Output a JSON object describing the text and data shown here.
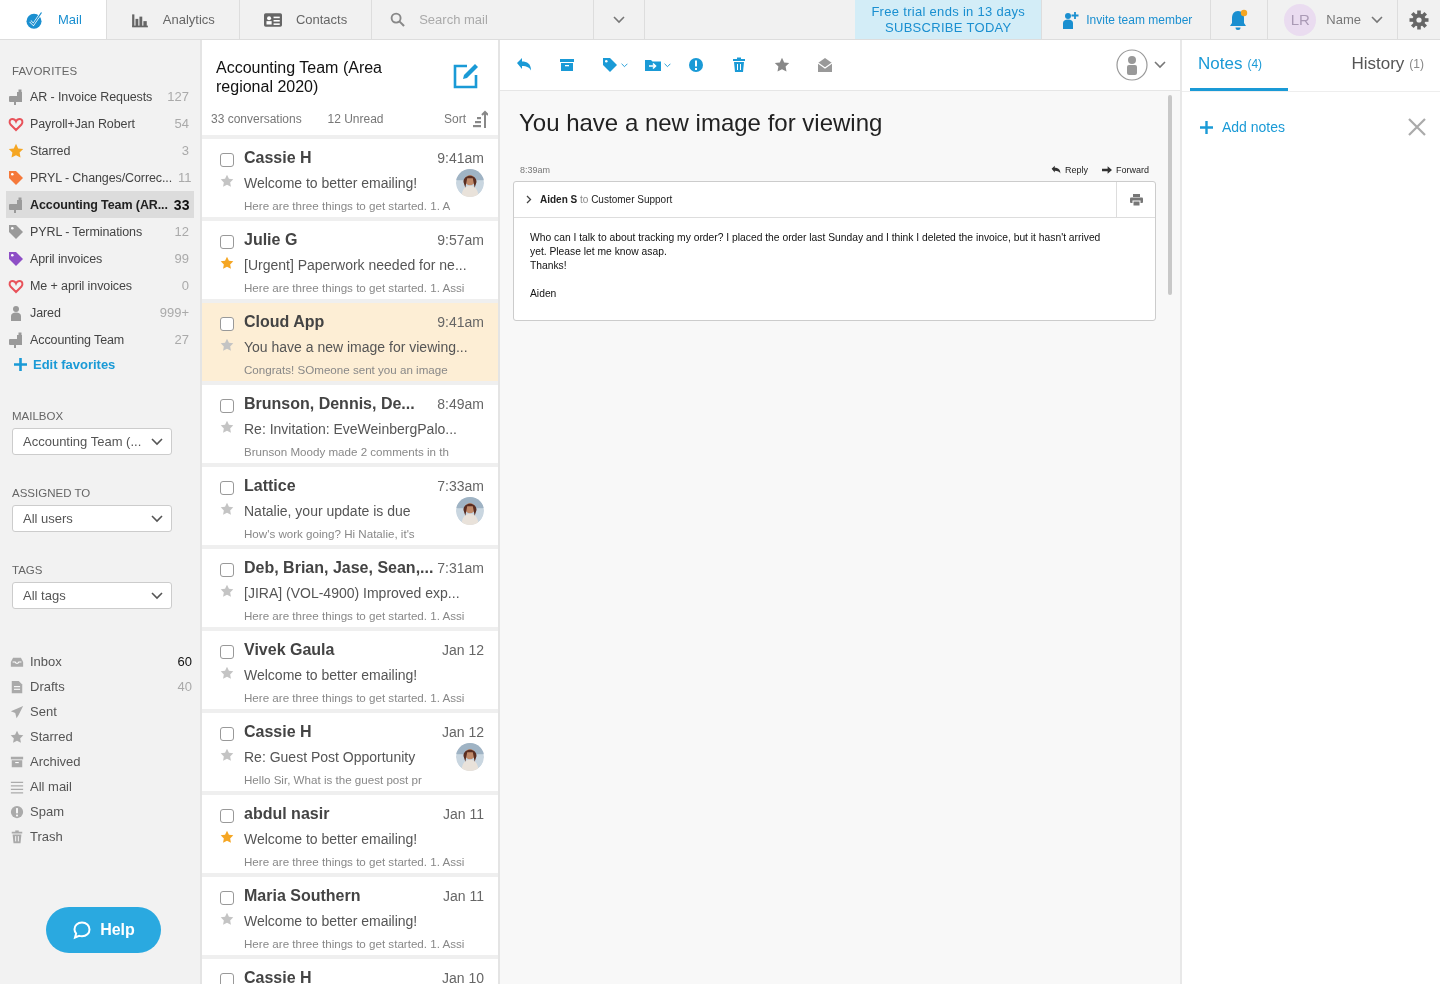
{
  "nav": {
    "tabs": [
      {
        "label": "Mail",
        "selected": true
      },
      {
        "label": "Analytics",
        "selected": false
      },
      {
        "label": "Contacts",
        "selected": false
      }
    ],
    "search": {
      "placeholder": "Search mail"
    },
    "trial": {
      "line1": "Free trial ends in 13 days",
      "line2": "SUBSCRIBE TODAY"
    },
    "invite": "Invite team member",
    "user": {
      "initials": "LR",
      "name": "Name"
    }
  },
  "favorites": {
    "heading": "FAVORITES",
    "items": [
      {
        "label": "AR - Invoice Requests",
        "count": "127",
        "kind": "mailbox",
        "color": "#9a9a9a",
        "selected": false
      },
      {
        "label": "Payroll+Jan Robert",
        "count": "54",
        "kind": "heart",
        "color": "#e8525a",
        "selected": false
      },
      {
        "label": "Starred",
        "count": "3",
        "kind": "star",
        "color": "#f5a623",
        "selected": false
      },
      {
        "label": "PRYL - Changes/Correc...",
        "count": "11",
        "kind": "tag",
        "color": "#f5793a",
        "selected": false
      },
      {
        "label": "Accounting Team (AR...",
        "count": "33",
        "kind": "mailbox",
        "color": "#9a9a9a",
        "selected": true
      },
      {
        "label": "PYRL - Terminations",
        "count": "12",
        "kind": "tag",
        "color": "#9a9a9a",
        "selected": false
      },
      {
        "label": "April invoices",
        "count": "99",
        "kind": "tag",
        "color": "#8e4fc6",
        "selected": false
      },
      {
        "label": "Me + april invoices",
        "count": "0",
        "kind": "heart",
        "color": "#e8525a",
        "selected": false
      },
      {
        "label": "Jared",
        "count": "999+",
        "kind": "person",
        "color": "#9a9a9a",
        "selected": false
      },
      {
        "label": "Accounting Team",
        "count": "27",
        "kind": "mailbox",
        "color": "#9a9a9a",
        "selected": false
      }
    ],
    "edit_label": "Edit favorites"
  },
  "filters": [
    {
      "label": "MAILBOX",
      "value": "Accounting Team (..."
    },
    {
      "label": "ASSIGNED TO",
      "value": "All users"
    },
    {
      "label": "TAGS",
      "value": "All tags"
    }
  ],
  "folders": [
    {
      "label": "Inbox",
      "count": "60",
      "unread": true
    },
    {
      "label": "Drafts",
      "count": "40",
      "unread": false
    },
    {
      "label": "Sent"
    },
    {
      "label": "Starred"
    },
    {
      "label": "Archived"
    },
    {
      "label": "All mail"
    },
    {
      "label": "Spam"
    },
    {
      "label": "Trash"
    }
  ],
  "help": "Help",
  "list": {
    "title": "Accounting Team (Area regional 2020)",
    "conversations": "33 conversations",
    "unread": "12 Unread",
    "sort": "Sort",
    "messages": [
      {
        "sender": "Cassie H",
        "time": "9:41am",
        "subject": "Welcome to better emailing!",
        "preview": "Here are three things to get started. 1. A",
        "checked": false,
        "starred": false,
        "selected": false,
        "avatar": true
      },
      {
        "sender": "Julie G",
        "time": "9:57am",
        "subject": "[Urgent] Paperwork needed for ne...",
        "preview": "Here are three things to get started. 1. Assi",
        "checked": false,
        "starred": true,
        "selected": false,
        "avatar": false
      },
      {
        "sender": "Cloud App",
        "time": "9:41am",
        "subject": "You have a new image for viewing...",
        "preview": "Congrats! SOmeone sent you an image",
        "checked": false,
        "starred": false,
        "selected": true,
        "avatar": false
      },
      {
        "sender": "Brunson, Dennis, De...",
        "time": "8:49am",
        "subject": "Re: Invitation: EveWeinbergPalo...",
        "preview": "Brunson Moody made 2 comments in th",
        "checked": false,
        "starred": false,
        "selected": false,
        "avatar": false
      },
      {
        "sender": "Lattice",
        "time": "7:33am",
        "subject": "Natalie, your update is due",
        "preview": "How's work going? Hi Natalie, it's",
        "checked": false,
        "starred": false,
        "selected": false,
        "avatar": true
      },
      {
        "sender": "Deb, Brian, Jase, Sean,...",
        "time": "7:31am",
        "subject": "[JIRA] (VOL-4900) Improved exp...",
        "preview": "Here are three things to get started. 1. Assi",
        "checked": false,
        "starred": false,
        "selected": false,
        "avatar": false
      },
      {
        "sender": "Vivek Gaula",
        "time": "Jan 12",
        "subject": "Welcome to better emailing!",
        "preview": "Here are three things to get started. 1. Assi",
        "checked": false,
        "starred": false,
        "selected": false,
        "avatar": false
      },
      {
        "sender": "Cassie H",
        "time": "Jan 12",
        "subject": "Re: Guest Post Opportunity",
        "preview": "Hello Sir, What is the guest  post pr",
        "checked": false,
        "starred": false,
        "selected": false,
        "avatar": true
      },
      {
        "sender": "abdul nasir",
        "time": "Jan 11",
        "subject": "Welcome to better emailing!",
        "preview": "Here are three things to get started. 1. Assi",
        "checked": false,
        "starred": true,
        "selected": false,
        "avatar": false
      },
      {
        "sender": "Maria Southern",
        "time": "Jan 11",
        "subject": "Welcome to better emailing!",
        "preview": "Here are three things to get started. 1. Assi",
        "checked": false,
        "starred": false,
        "selected": false,
        "avatar": false
      },
      {
        "sender": "Cassie H",
        "time": "Jan 10",
        "checked": false,
        "selected": false
      }
    ]
  },
  "reader": {
    "subject": "You have a new image for viewing",
    "time": "8:39am",
    "reply": "Reply",
    "forward": "Forward",
    "from": "Aiden S",
    "to_word": "to",
    "recipient": "Customer Support",
    "body": [
      "Who can I talk to about tracking my order? I placed the order last Sunday and I think I deleted the invoice, but it hasn't arrived yet. Please let me know asap.",
      "Thanks!"
    ],
    "signature": "Aiden"
  },
  "notes": {
    "tabs": [
      {
        "label": "Notes",
        "count": "(4)",
        "selected": true
      },
      {
        "label": "History",
        "count": "(1)",
        "selected": false
      }
    ],
    "add_label": "Add notes"
  }
}
